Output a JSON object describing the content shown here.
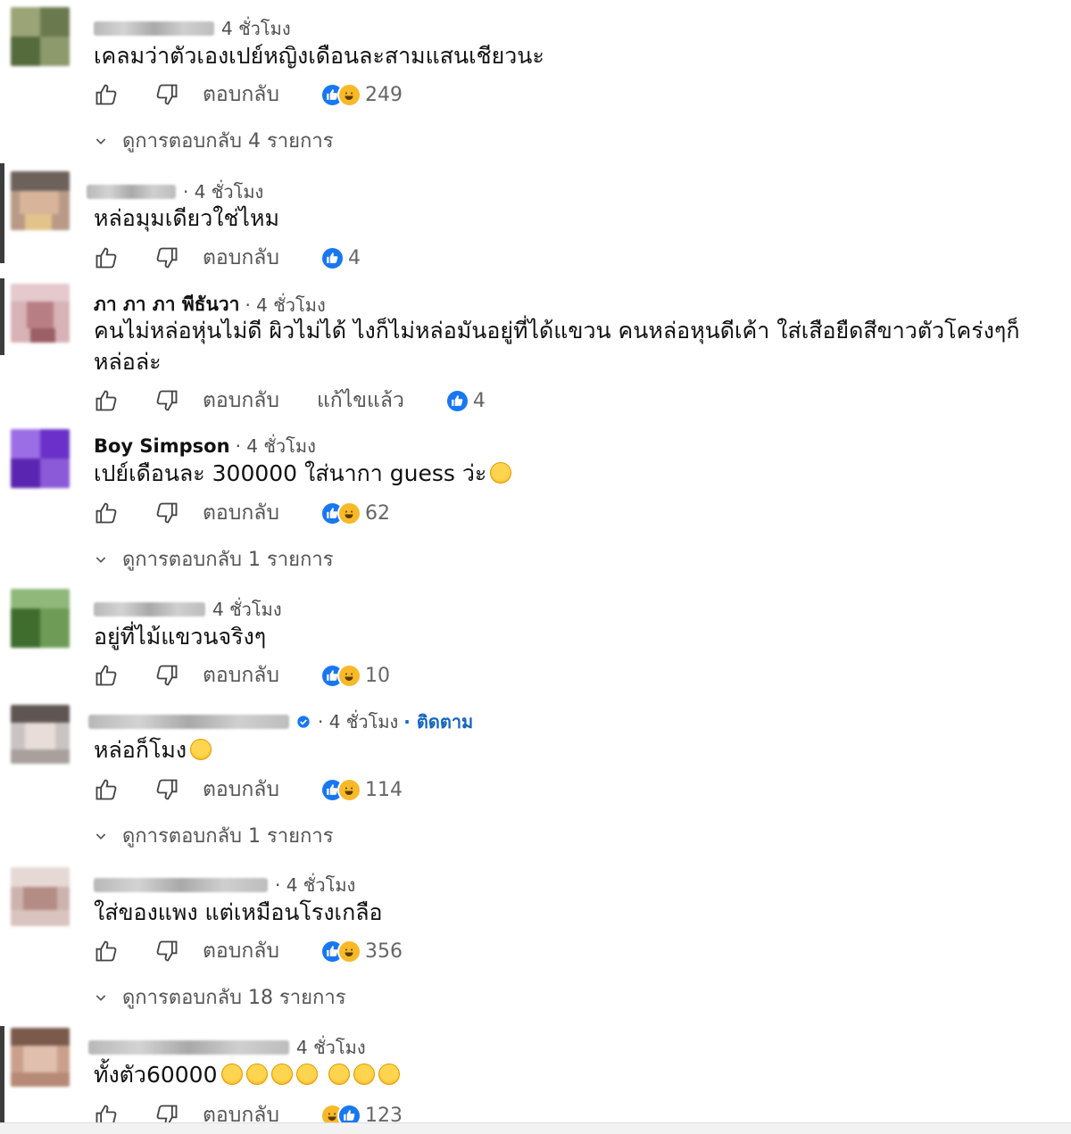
{
  "labels": {
    "reply": "ตอบกลับ",
    "edited": "แก้ไขแล้ว"
  },
  "comments": [
    {
      "time": "4 ชั่วโมง",
      "text": "เคลมว่าตัวเองเปย์หญิงเดือนละสามแสนเชียวนะ",
      "reactions": "249",
      "view_replies": "ดูการตอบกลับ 4 รายการ"
    },
    {
      "time": "· 4 ชั่วโมง",
      "text": "หล่อมุมเดียวใช่ไหม",
      "reactions": "4"
    },
    {
      "name": "ภา ภา ภา พีธันวา",
      "time": "· 4 ชั่วโมง",
      "text": "คนไม่หล่อหุ่นไม่ดี ผิวไม่ได้ ไงก็ไม่หล่อมันอยู่ที่ได้แขวน คนหล่อหุนดีเค้า ใส่เสือยืดสีขาวตัวโคร่งๆก็หล่อล่ะ",
      "reactions": "4"
    },
    {
      "name": "Boy Simpson",
      "time": "· 4 ชั่วโมง",
      "text": "เปย์เดือนละ 300000 ใส่นากา guess ว่ะ",
      "reactions": "62",
      "view_replies": "ดูการตอบกลับ 1 รายการ"
    },
    {
      "time": "4 ชั่วโมง",
      "text": "อยู่ที่ไม้แขวนจริงๆ",
      "reactions": "10"
    },
    {
      "time": "· 4 ชั่วโมง",
      "follow": "· ติดตาม",
      "text": "หล่อก็โมง",
      "reactions": "114",
      "view_replies": "ดูการตอบกลับ 1 รายการ"
    },
    {
      "time": "· 4 ชั่วโมง",
      "text": "ใส่ของแพง แต่เหมือนโรงเกลือ",
      "reactions": "356",
      "view_replies": "ดูการตอบกลับ 18 รายการ"
    },
    {
      "time": "4 ชั่วโมง",
      "text": "ทั้งตัว60000",
      "reactions": "123"
    }
  ]
}
